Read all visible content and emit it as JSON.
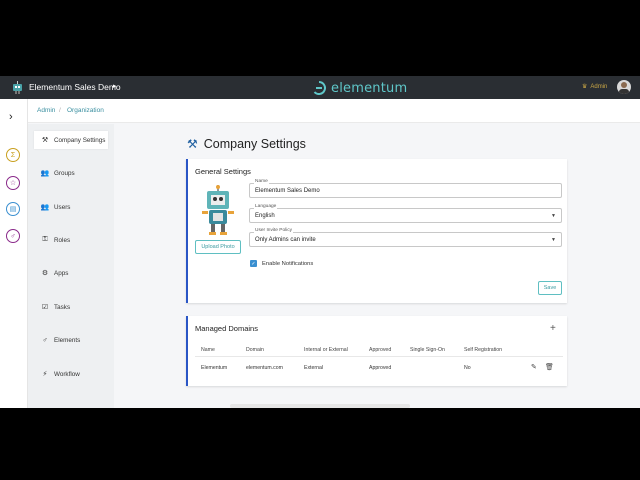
{
  "topbar": {
    "app_name": "Elementum Sales Demo",
    "brand": "elementum",
    "admin_label": "Admin",
    "brand_color": "#5fc7c9"
  },
  "breadcrumb": [
    "Admin",
    "/",
    "Organization"
  ],
  "settings_nav": [
    {
      "label": "Company Settings",
      "icon": "tools-icon",
      "active": true
    },
    {
      "label": "Groups",
      "icon": "groups-icon"
    },
    {
      "label": "Users",
      "icon": "users-icon"
    },
    {
      "label": "Roles",
      "icon": "roles-icon"
    },
    {
      "label": "Apps",
      "icon": "apps-icon"
    },
    {
      "label": "Tasks",
      "icon": "tasks-icon"
    },
    {
      "label": "Elements",
      "icon": "elements-icon"
    },
    {
      "label": "Workflow",
      "icon": "workflow-icon"
    }
  ],
  "page_title": "Company Settings",
  "general": {
    "title": "General Settings",
    "upload_label": "Upload Photo",
    "name_label": "Name",
    "name_value": "Elementum Sales Demo",
    "language_label": "Language",
    "language_value": "English",
    "invite_label": "User Invite Policy",
    "invite_value": "Only Admins can invite",
    "notifications_label": "Enable Notifications",
    "notifications_checked": true,
    "save_label": "Save"
  },
  "domains": {
    "title": "Managed Domains",
    "columns": [
      "Name",
      "Domain",
      "Internal or External",
      "Approved",
      "Single Sign-On",
      "Self Registration"
    ],
    "rows": [
      [
        "Elementum",
        "elementum.com",
        "External",
        "Approved",
        "",
        "No"
      ]
    ]
  }
}
